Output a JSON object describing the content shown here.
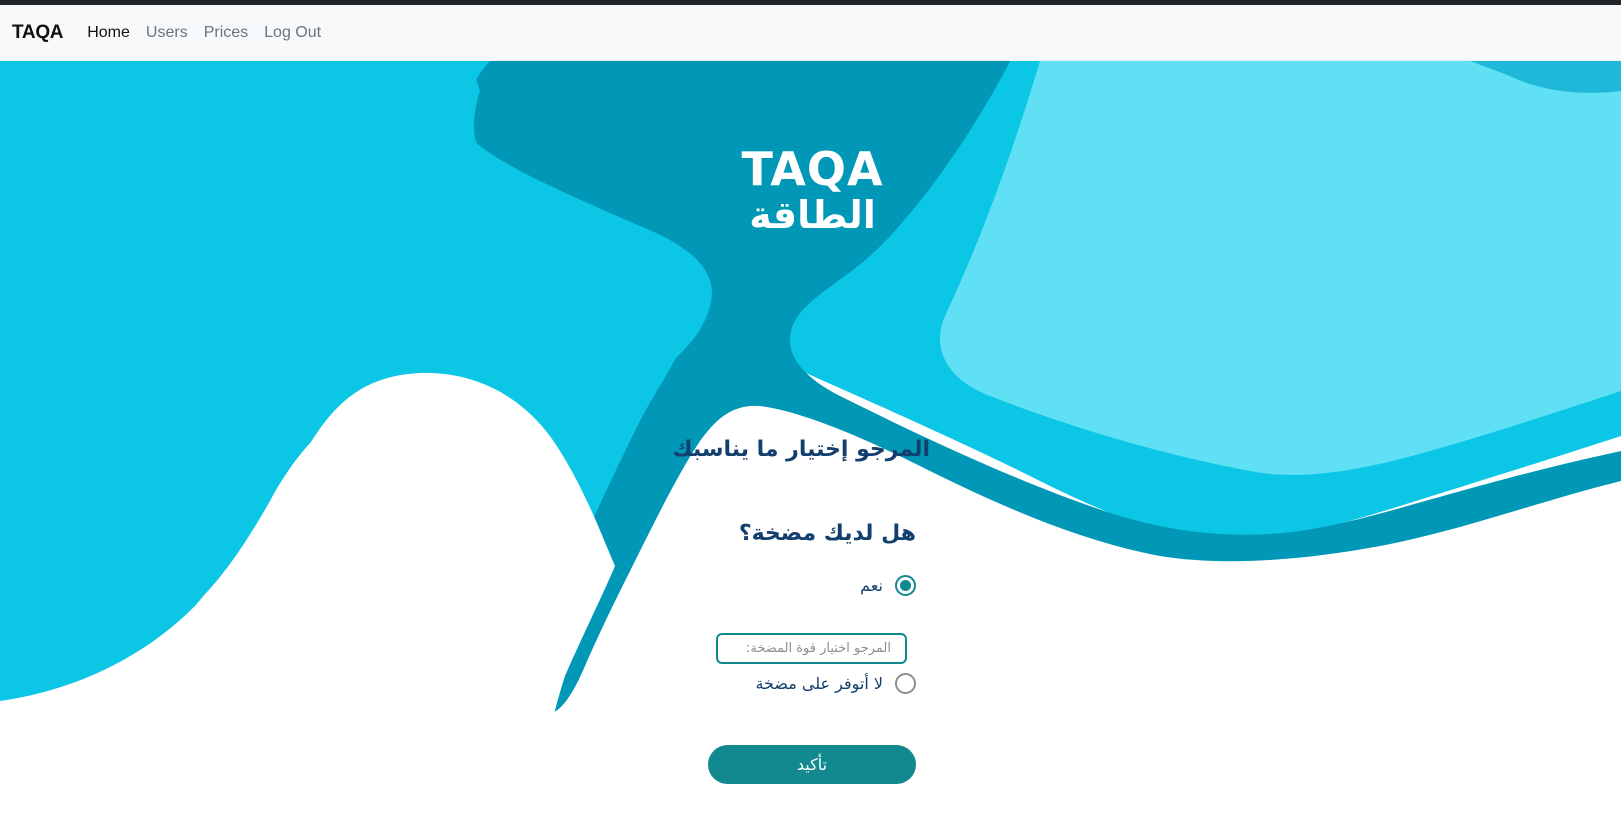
{
  "navbar": {
    "brand": "TAQA",
    "links": [
      {
        "label": "Home",
        "active": true
      },
      {
        "label": "Users",
        "active": false
      },
      {
        "label": "Prices",
        "active": false
      },
      {
        "label": "Log Out",
        "active": false
      }
    ]
  },
  "logo": {
    "english": "TAQA",
    "arabic": "الطاقة"
  },
  "form": {
    "title": "المرجو إختيار ما يناسبك",
    "question": "هل لديك مضخة؟",
    "options": [
      {
        "label": "نعم",
        "selected": true
      },
      {
        "label": "لا أتوفر على مضخة",
        "selected": false
      }
    ],
    "power_input": {
      "placeholder": "المرجو اختيار قوة المضخة:",
      "value": ""
    },
    "confirm_label": "تأكيد"
  },
  "colors": {
    "navbar_bg": "#f8f9fa",
    "primary_teal": "#11898f",
    "heading_blue": "#123f6e",
    "cyan_light": "#5fe0f5",
    "cyan_mid": "#0cc6e6",
    "cyan_dark": "#0098b6"
  }
}
